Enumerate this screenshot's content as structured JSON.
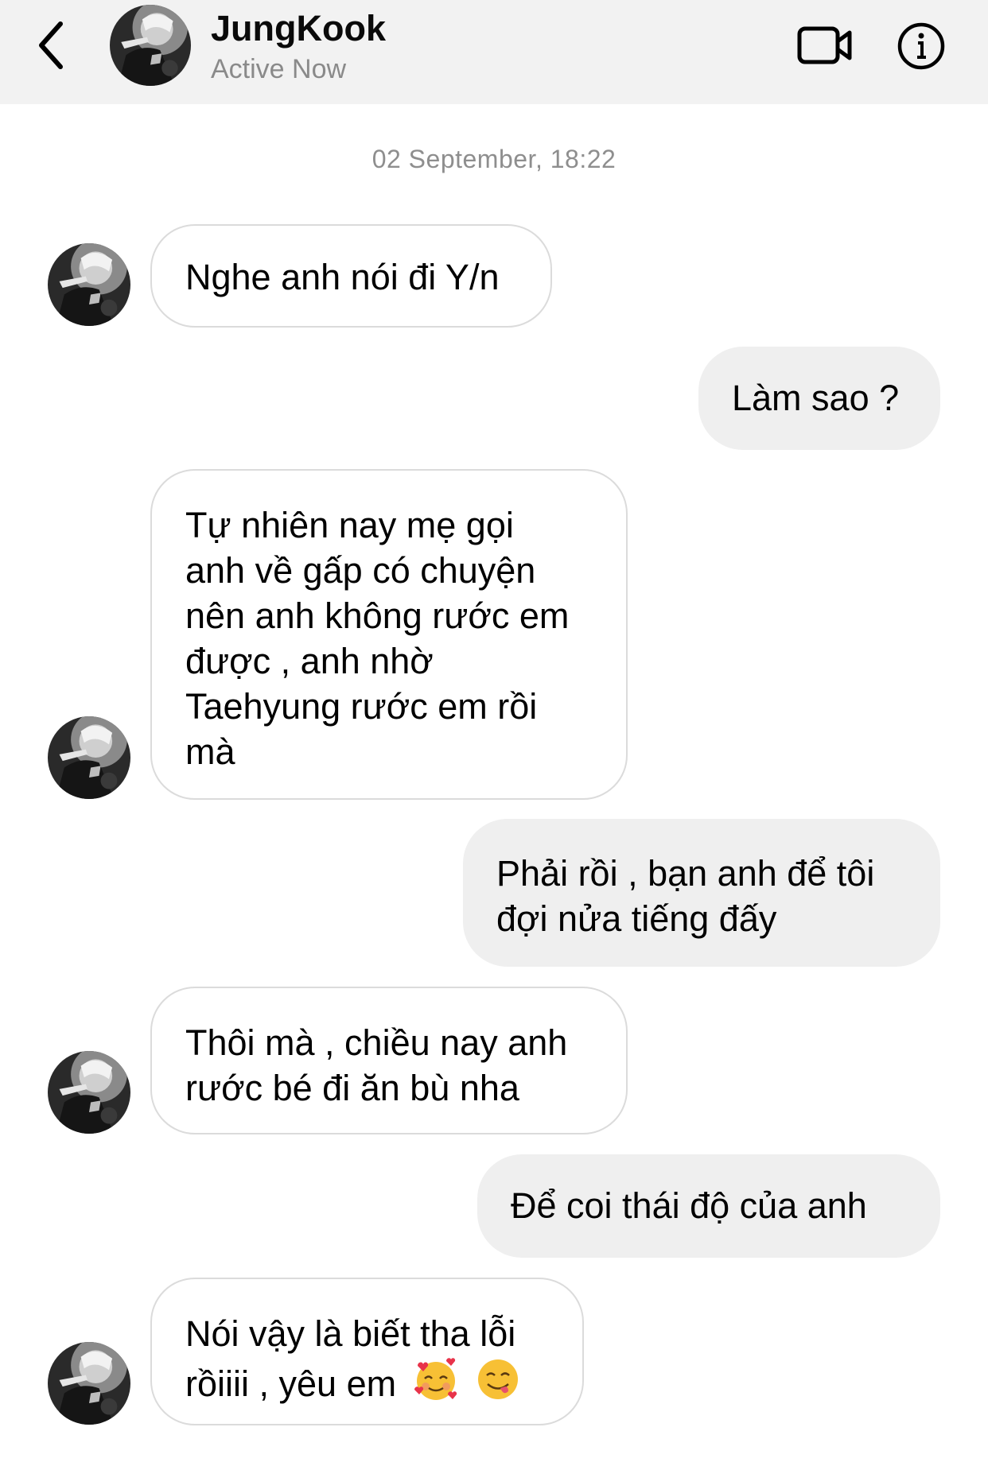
{
  "header": {
    "back_icon": "chevron-left-icon",
    "contact_name": "JungKook",
    "status": "Active Now",
    "video_icon": "video-camera-icon",
    "info_icon": "info-icon"
  },
  "conversation": {
    "timestamp": "02 September, 18:22",
    "messages": [
      {
        "sender": "JungKook",
        "direction": "incoming",
        "lines": [
          "Nghe anh nói đi Y/n"
        ]
      },
      {
        "sender": "me",
        "direction": "outgoing",
        "lines": [
          "Làm sao ?"
        ]
      },
      {
        "sender": "JungKook",
        "direction": "incoming",
        "lines": [
          "Tự nhiên nay mẹ gọi",
          "anh về gấp có chuyện",
          "nên anh không rước em",
          "được , anh nhờ",
          "Taehyung rước em rồi",
          "mà"
        ]
      },
      {
        "sender": "me",
        "direction": "outgoing",
        "lines": [
          "Phải rồi , bạn anh để tôi",
          "đợi nửa tiếng đấy"
        ]
      },
      {
        "sender": "JungKook",
        "direction": "incoming",
        "lines": [
          "Thôi mà , chiều nay anh",
          "rước bé đi ăn bù nha"
        ]
      },
      {
        "sender": "me",
        "direction": "outgoing",
        "lines": [
          "Để coi thái độ của anh"
        ]
      },
      {
        "sender": "JungKook",
        "direction": "incoming",
        "lines": [
          "Nói vậy là biết tha lỗi",
          "rồiiii , yêu em"
        ],
        "emojis": [
          "smiling-face-with-hearts-emoji",
          "face-savoring-food-emoji"
        ]
      }
    ]
  },
  "colors": {
    "header_bg": "#f2f2f2",
    "incoming_border": "#dbdbdb",
    "outgoing_bg": "#efefef",
    "status_text": "#8a8a8a",
    "timestamp_text": "#8e8e8e"
  }
}
